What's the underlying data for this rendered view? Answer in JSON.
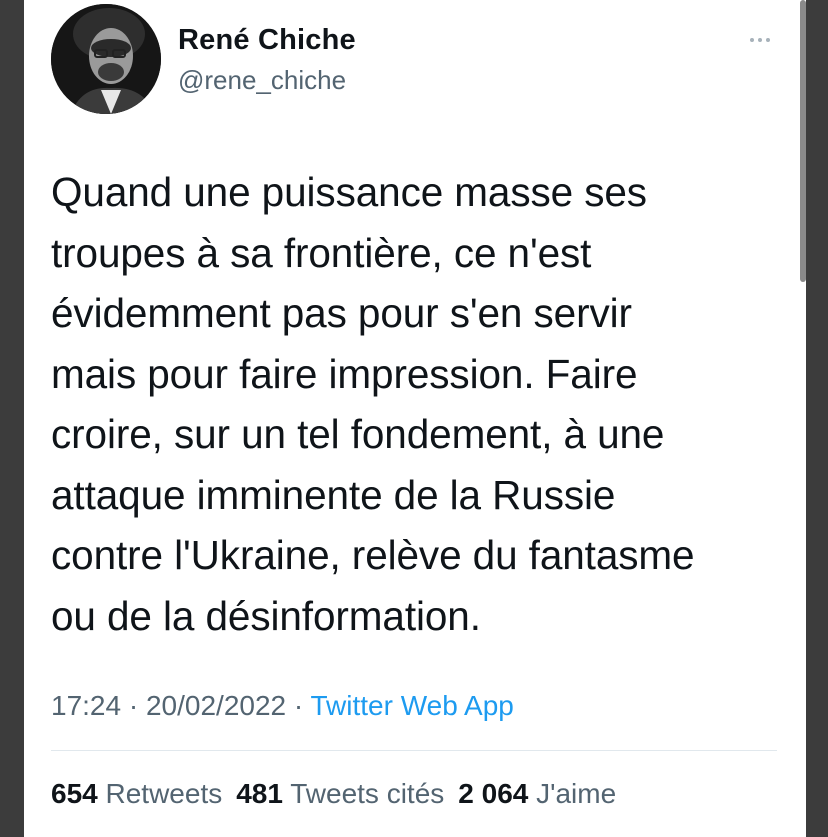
{
  "author": {
    "display_name": "René Chiche",
    "handle": "@rene_chiche",
    "avatar": "profile-photo"
  },
  "more_icon": "ellipsis-icon",
  "tweet": {
    "text": "Quand une puissance masse ses\ntroupes à sa frontière, ce n'est\névidemment pas pour s'en servir\nmais pour faire impression. Faire\ncroire, sur un tel fondement, à une\nattaque imminente de la Russie\ncontre l'Ukraine, relève du fantasme\nou de la désinformation."
  },
  "meta": {
    "time": "17:24",
    "separator": " · ",
    "date": "20/02/2022",
    "source": "Twitter Web App"
  },
  "stats": {
    "retweets_count": "654",
    "retweets_label": "Retweets",
    "quotes_count": "481",
    "quotes_label": "Tweets cités",
    "likes_count": "2 064",
    "likes_label": "J'aime"
  },
  "colors": {
    "text": "#0f1419",
    "secondary": "#536471",
    "link": "#1d9bf0",
    "divider": "#e1e8ed"
  }
}
